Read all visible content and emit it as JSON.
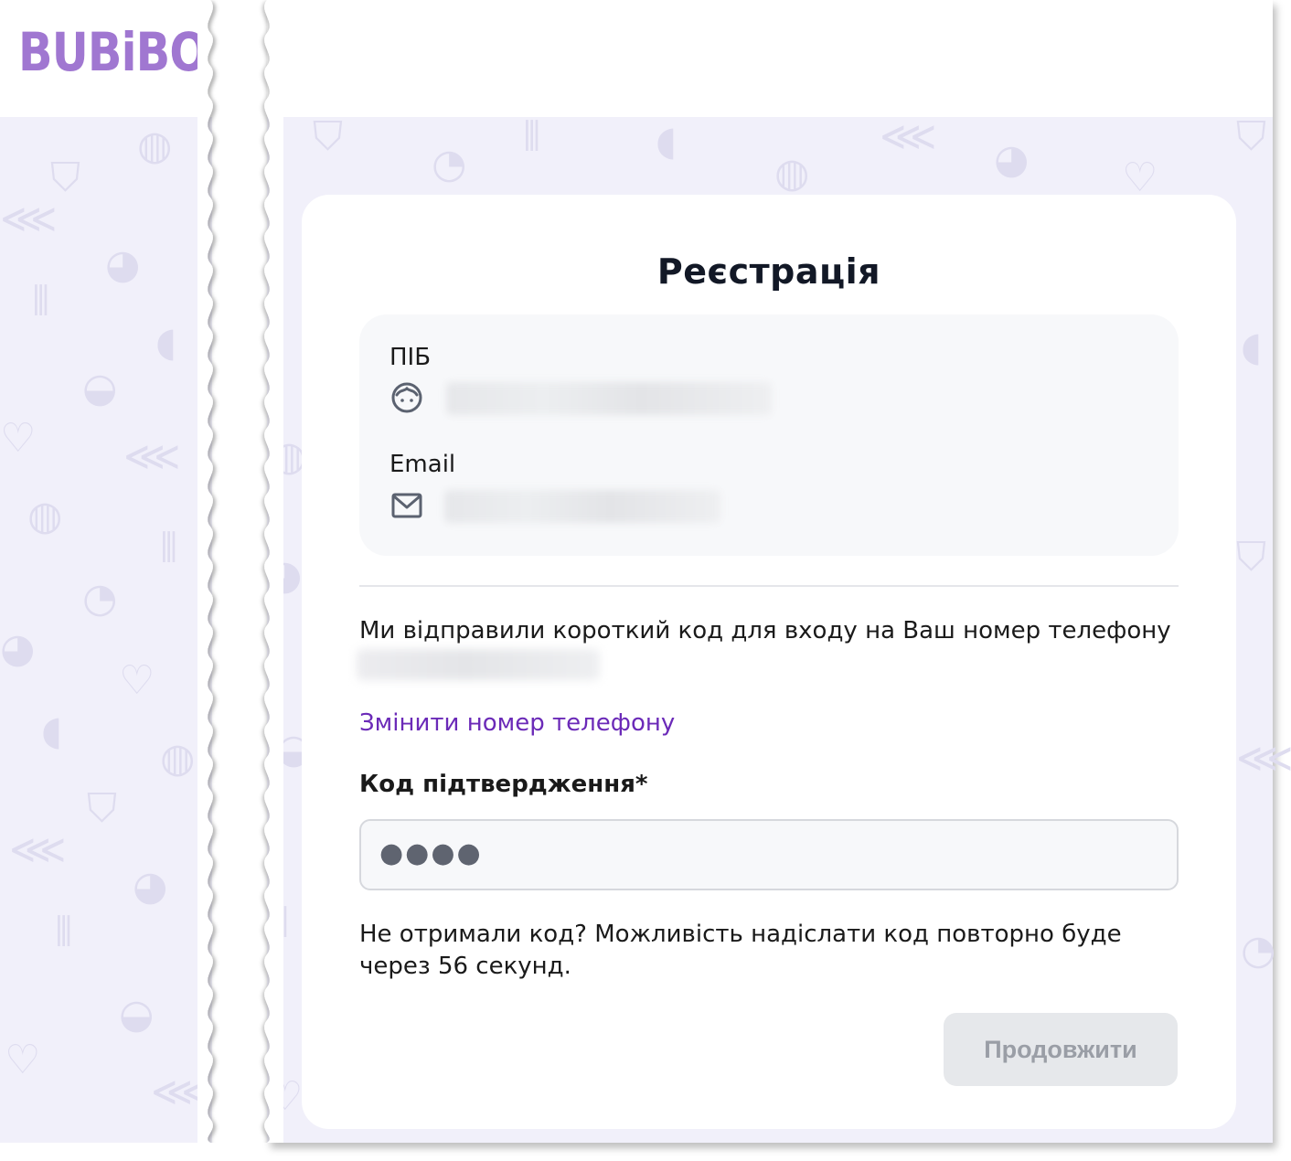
{
  "brand": {
    "logo_text": "BUBiBO",
    "accent_color": "#a077d1"
  },
  "form": {
    "title": "Реєстрація",
    "name_field": {
      "label": "ПІБ",
      "icon": "person-face-icon"
    },
    "email_field": {
      "label": "Email",
      "icon": "mail-icon"
    },
    "sent_message": "Ми відправили короткий код для входу на Ваш номер телефону",
    "change_phone_link": "Змінити номер телефону",
    "code_label": "Код підтвердження*",
    "code_value": "●●●●",
    "resend_message": "Не отримали код?  Можливість надіслати код повторно буде через 56 секунд.",
    "continue_button": "Продовжити"
  },
  "colors": {
    "link": "#6b2ab8",
    "pattern_bg": "#f1f0fa",
    "button_disabled_bg": "#e6e8eb",
    "button_disabled_text": "#9a9ea6"
  }
}
